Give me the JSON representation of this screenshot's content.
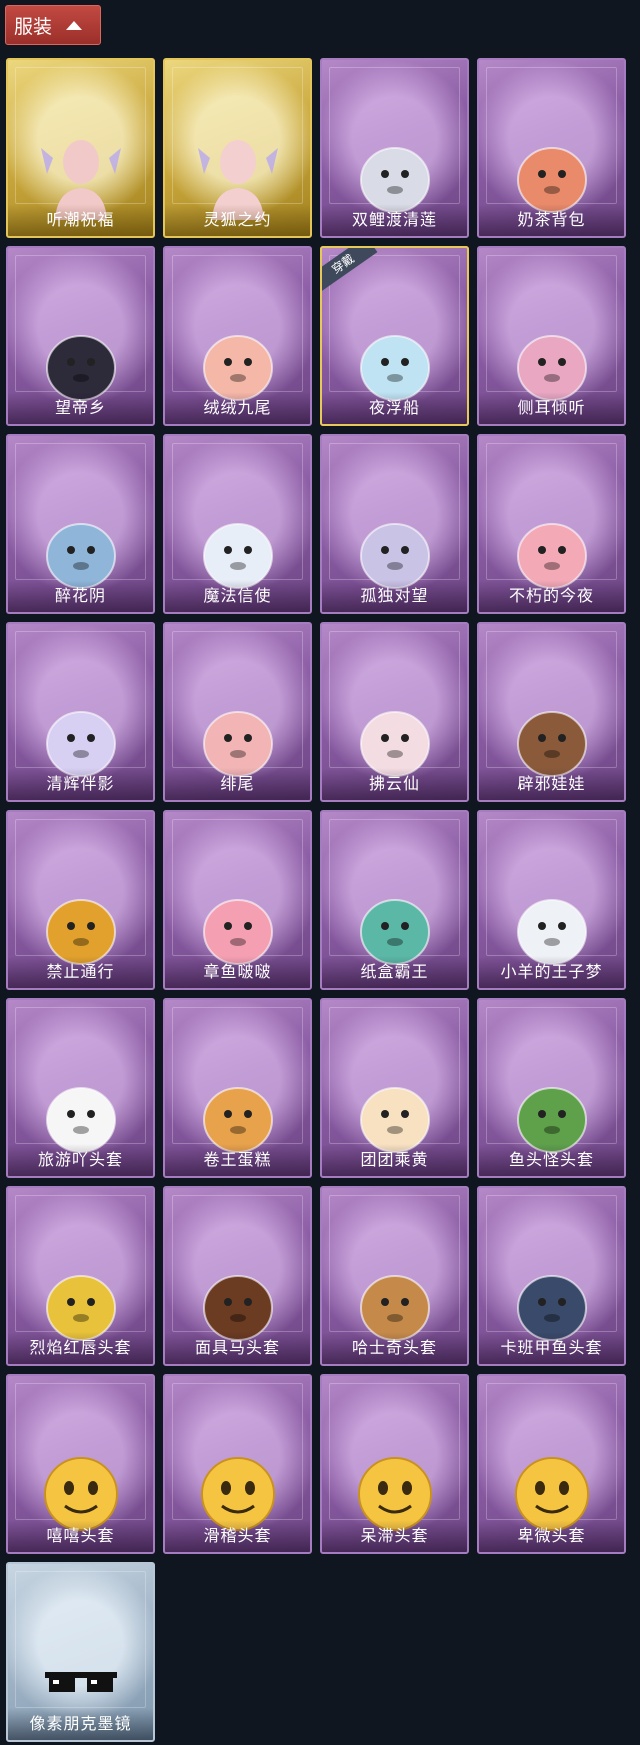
{
  "header": {
    "label": "服装",
    "icon": "chevron-up-icon"
  },
  "badge_equipped": "穿戴",
  "items": [
    {
      "name": "听潮祝福",
      "frame": "gold",
      "icon": "bust-fairy-icon",
      "color": "#f2c9c9"
    },
    {
      "name": "灵狐之约",
      "frame": "gold",
      "icon": "bust-fox-icon",
      "color": "#f4cfcf"
    },
    {
      "name": "双鲤渡清莲",
      "frame": "purple",
      "icon": "koi-lotus-icon",
      "color": "#d9dce6"
    },
    {
      "name": "奶茶背包",
      "frame": "purple",
      "icon": "milk-tea-backpack-icon",
      "color": "#e98a6a"
    },
    {
      "name": "望帝乡",
      "frame": "purple",
      "icon": "chibi-figure-icon",
      "color": "#2d2a3a"
    },
    {
      "name": "绒绒九尾",
      "frame": "purple",
      "icon": "nine-tail-fox-icon",
      "color": "#f5b7a8"
    },
    {
      "name": "夜浮船",
      "frame": "purple",
      "icon": "jellyfish-icon",
      "color": "#bfe3f2",
      "equipped": true
    },
    {
      "name": "侧耳倾听",
      "frame": "purple",
      "icon": "lotus-wreath-icon",
      "color": "#e9a7c2"
    },
    {
      "name": "醉花阴",
      "frame": "purple",
      "icon": "flower-fan-icon",
      "color": "#8fb6d9"
    },
    {
      "name": "魔法信使",
      "frame": "purple",
      "icon": "elephant-icon",
      "color": "#e8eef7"
    },
    {
      "name": "孤独对望",
      "frame": "purple",
      "icon": "chibi-charm-icon",
      "color": "#c9c3e6"
    },
    {
      "name": "不朽的今夜",
      "frame": "purple",
      "icon": "pink-fox-bowl-icon",
      "color": "#f4a9b7"
    },
    {
      "name": "清辉伴影",
      "frame": "purple",
      "icon": "chibi-charm-icon",
      "color": "#d7d0f3"
    },
    {
      "name": "绯尾",
      "frame": "purple",
      "icon": "fox-charm-icon",
      "color": "#f2b4b4"
    },
    {
      "name": "拂云仙",
      "frame": "purple",
      "icon": "chibi-charm-icon",
      "color": "#f3dce2"
    },
    {
      "name": "辟邪娃娃",
      "frame": "purple",
      "icon": "doll-head-icon",
      "color": "#8a5a3a"
    },
    {
      "name": "禁止通行",
      "frame": "purple",
      "icon": "no-entry-sign-icon",
      "color": "#e2a12c"
    },
    {
      "name": "章鱼啵啵",
      "frame": "purple",
      "icon": "octopus-icon",
      "color": "#f5a0b2"
    },
    {
      "name": "纸盒霸王",
      "frame": "purple",
      "icon": "cardboard-dino-icon",
      "color": "#5bb7a6"
    },
    {
      "name": "小羊的王子梦",
      "frame": "purple",
      "icon": "sheep-crown-icon",
      "color": "#eef1f6"
    },
    {
      "name": "旅游吖头套",
      "frame": "purple",
      "icon": "duck-hat-icon",
      "color": "#f6f6f6"
    },
    {
      "name": "卷王蛋糕",
      "frame": "purple",
      "icon": "cake-roll-icon",
      "color": "#e8a24c"
    },
    {
      "name": "团团乘黄",
      "frame": "purple",
      "icon": "round-cat-icon",
      "color": "#f7e1c1"
    },
    {
      "name": "鱼头怪头套",
      "frame": "purple",
      "icon": "fish-head-icon",
      "color": "#5fa04b"
    },
    {
      "name": "烈焰红唇头套",
      "frame": "purple",
      "icon": "yellow-mouse-sunglasses-icon",
      "color": "#e7c23a"
    },
    {
      "name": "面具马头套",
      "frame": "purple",
      "icon": "horse-head-icon",
      "color": "#6b3b22"
    },
    {
      "name": "哈士奇头套",
      "frame": "purple",
      "icon": "dog-sunglasses-icon",
      "color": "#c58a4a"
    },
    {
      "name": "卡班甲鱼头套",
      "frame": "purple",
      "icon": "whale-fish-icon",
      "color": "#3a4a6a"
    },
    {
      "name": "嘻嘻头套",
      "frame": "purple",
      "icon": "grin-emoji-icon",
      "color": "#f5c542"
    },
    {
      "name": "滑稽头套",
      "frame": "purple",
      "icon": "smirk-emoji-icon",
      "color": "#f5c542"
    },
    {
      "name": "呆滞头套",
      "frame": "purple",
      "icon": "dazed-emoji-icon",
      "color": "#f5c542"
    },
    {
      "name": "卑微头套",
      "frame": "purple",
      "icon": "timid-emoji-icon",
      "color": "#f5c542"
    },
    {
      "name": "像素朋克墨镜",
      "frame": "silver",
      "icon": "pixel-sunglasses-icon",
      "color": "#111111"
    }
  ]
}
